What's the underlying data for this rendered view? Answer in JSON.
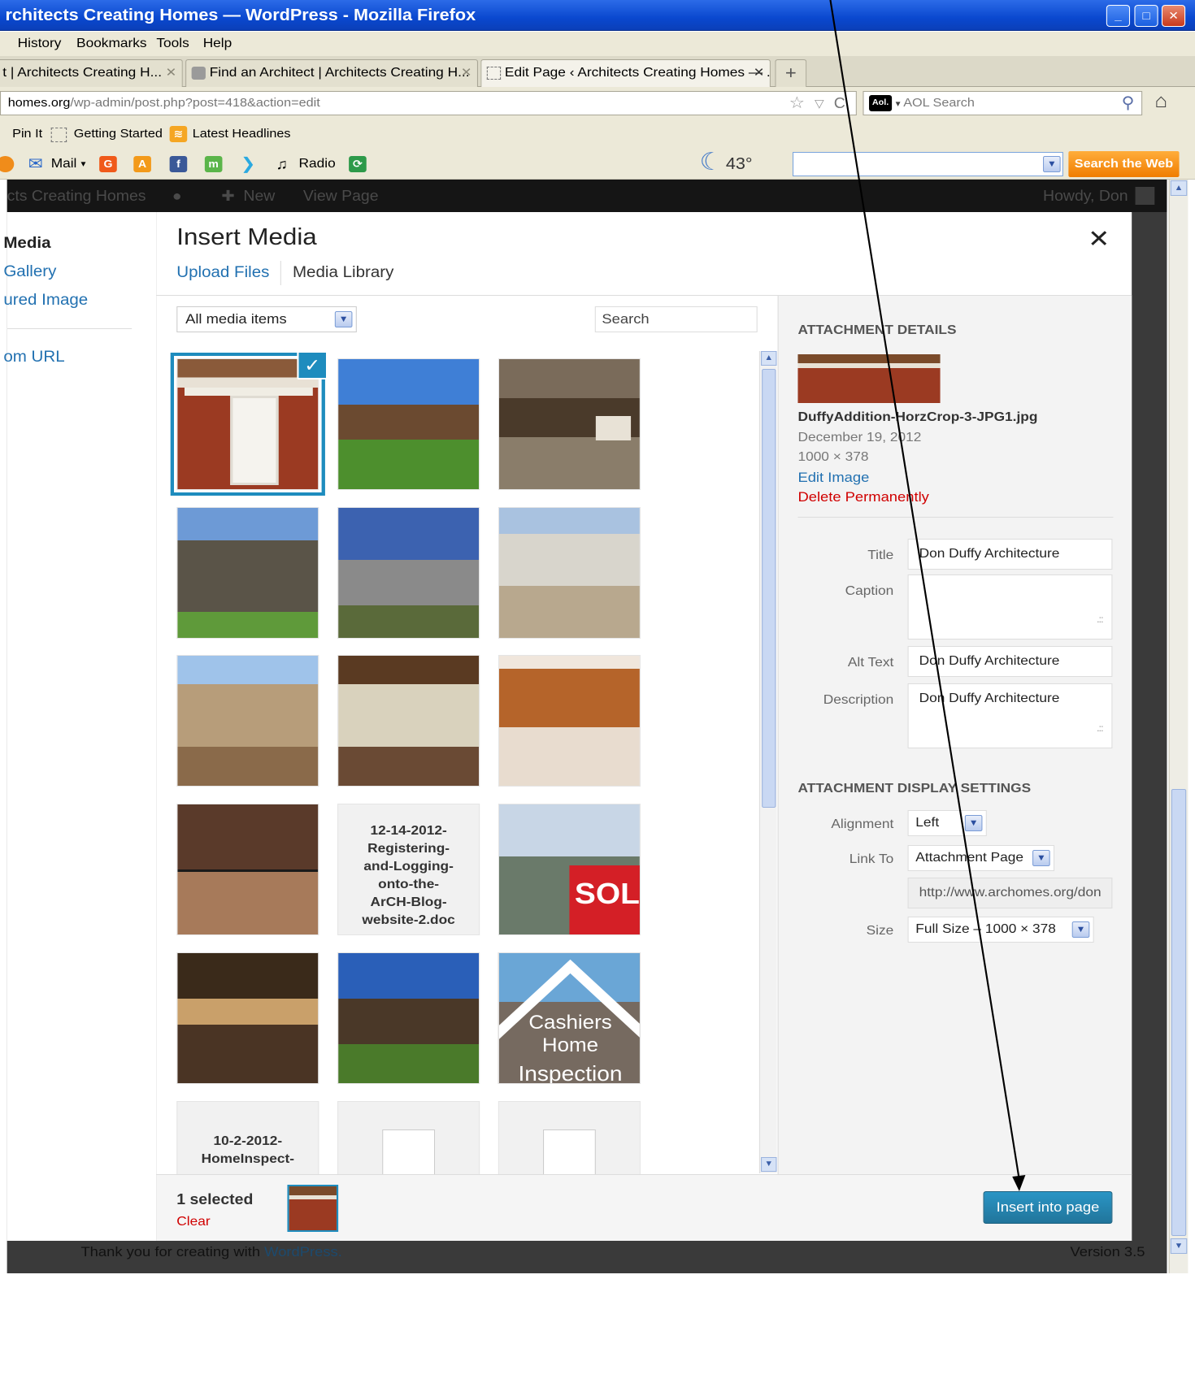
{
  "window": {
    "title": "rchitects Creating Homes — WordPress - Mozilla Firefox"
  },
  "menu": [
    "History",
    "Bookmarks",
    "Tools",
    "Help"
  ],
  "tabs": [
    {
      "label": "t | Architects Creating H..."
    },
    {
      "label": "Find an Architect | Architects Creating H..."
    },
    {
      "label": "Edit Page ‹ Architects Creating Homes — ..."
    }
  ],
  "url": {
    "host": "homes.org",
    "path": "/wp-admin/post.php?post=418&action=edit"
  },
  "browser_search": {
    "placeholder": "AOL Search"
  },
  "bookmarks": [
    "Pin It",
    "Getting Started",
    "Latest Headlines"
  ],
  "aol_toolbar": {
    "mail": "Mail",
    "radio": "Radio",
    "weather": "43°",
    "search_button": "Search the Web"
  },
  "wp_admin": {
    "site": "cts Creating Homes",
    "new": "New",
    "view": "View Page",
    "howdy": "Howdy, Don",
    "footer_text": "Thank you for creating with",
    "footer_link": "WordPress.",
    "version": "Version 3.5"
  },
  "left_menu": {
    "media": "Media",
    "gallery": "Gallery",
    "featured": "ured Image",
    "from_url": "om URL"
  },
  "modal": {
    "title": "Insert Media",
    "tab_upload": "Upload Files",
    "tab_library": "Media Library",
    "filter": "All media items",
    "search_placeholder": "Search"
  },
  "grid_docs": {
    "doc1": "12-14-2012-Registering-and-Logging-onto-the-ArCH-Blog-website-2.doc",
    "doc1_lines": [
      "12-14-2012-",
      "Registering-",
      "and-Logging-",
      "onto-the-",
      "ArCH-Blog-",
      "website-2.doc"
    ],
    "doc2_lines": [
      "10-2-2012-",
      "HomeInspect-"
    ],
    "sold": "SOLD",
    "cashiers": [
      "Cashiers",
      "Home",
      "Inspection"
    ]
  },
  "attachment": {
    "heading": "ATTACHMENT DETAILS",
    "filename": "DuffyAddition-HorzCrop-3-JPG1.jpg",
    "date": "December 19, 2012",
    "dimensions": "1000 × 378",
    "edit": "Edit Image",
    "delete": "Delete Permanently",
    "title_label": "Title",
    "title_value": "Don Duffy Architecture",
    "caption_label": "Caption",
    "caption_value": "",
    "alt_label": "Alt Text",
    "alt_value": "Don Duffy Architecture",
    "desc_label": "Description",
    "desc_value": "Don Duffy Architecture"
  },
  "display": {
    "heading": "ATTACHMENT DISPLAY SETTINGS",
    "align_label": "Alignment",
    "align_value": "Left",
    "link_label": "Link To",
    "link_value": "Attachment Page",
    "link_url": "http://www.archomes.org/don",
    "size_label": "Size",
    "size_value": "Full Size – 1000 × 378"
  },
  "selection": {
    "count": "1 selected",
    "clear": "Clear"
  },
  "insert_button": "Insert into page",
  "colors": {
    "wp_blue": "#2271b1",
    "delete_red": "#d00000",
    "insert_button": "#21759b"
  }
}
